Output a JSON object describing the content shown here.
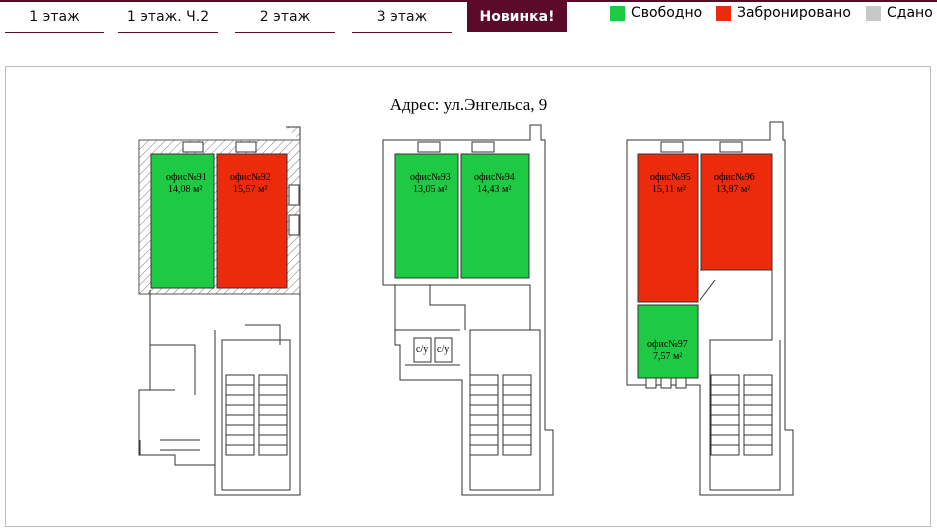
{
  "tabs": [
    {
      "label": "1 этаж",
      "active": false
    },
    {
      "label": "1 этаж. Ч.2",
      "active": false
    },
    {
      "label": "2 этаж",
      "active": false
    },
    {
      "label": "3 этаж",
      "active": false
    },
    {
      "label": "Новинка!",
      "active": true
    }
  ],
  "legend": [
    {
      "label": "Свободно",
      "color": "#1ec943"
    },
    {
      "label": "Забронировано",
      "color": "#ec2a0c"
    },
    {
      "label": "Сдано",
      "color": "#c8c8c8"
    }
  ],
  "address": "Адрес: ул.Энгельса, 9",
  "offices": [
    {
      "name": "офис№91",
      "area": "14,08 м²",
      "status": "free"
    },
    {
      "name": "офис№92",
      "area": "15,57 м²",
      "status": "reserved"
    },
    {
      "name": "офис№93",
      "area": "13,05 м²",
      "status": "free"
    },
    {
      "name": "офис№94",
      "area": "14,43 м²",
      "status": "free"
    },
    {
      "name": "офис№95",
      "area": "15,11 м²",
      "status": "reserved"
    },
    {
      "name": "офис№96",
      "area": "13,87 м²",
      "status": "reserved"
    },
    {
      "name": "офис№97",
      "area": "7,57 м²",
      "status": "free"
    }
  ],
  "wc_labels": [
    "с/у",
    "с/у"
  ],
  "status_colors": {
    "free": "#1ec943",
    "reserved": "#ec2a0c",
    "rented": "#c8c8c8"
  }
}
